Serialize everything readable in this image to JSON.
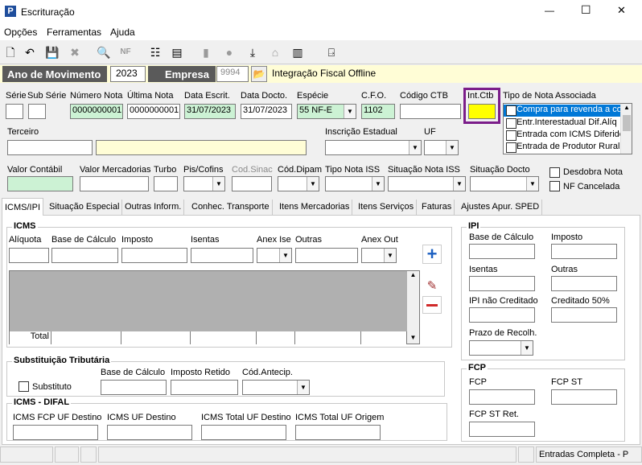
{
  "window": {
    "title": "Escrituração",
    "minimize": "—",
    "maximize": "☐",
    "close": "✕"
  },
  "menu": [
    "Opções",
    "Ferramentas",
    "Ajuda"
  ],
  "header": {
    "ano_label": "Ano de Movimento",
    "ano_value": "2023",
    "empresa_label": "Empresa",
    "empresa_code": "9994",
    "empresa_name": "Integração Fiscal Offline"
  },
  "labels": {
    "serie": "Série",
    "subserie": "Sub Série",
    "numero_nota": "Número Nota",
    "ultima_nota": "Última Nota",
    "data_escrit": "Data Escrit.",
    "data_docto": "Data Docto.",
    "especie": "Espécie",
    "cfo": "C.F.O.",
    "codigo_ctb": "Código CTB",
    "int_ctb": "Int.Ctb",
    "tipo_nota_assoc": "Tipo de Nota Associada",
    "terceiro": "Terceiro",
    "inscricao": "Inscrição Estadual",
    "uf": "UF",
    "valor_contabil": "Valor Contábil",
    "valor_mercadorias": "Valor Mercadorias",
    "turbo": "Turbo",
    "pis_cofins": "Pis/Cofins",
    "cod_sinac": "Cod.Sinac",
    "cod_dipam": "Cód.Dipam",
    "tipo_nota_iss": "Tipo Nota ISS",
    "situacao_nota_iss": "Situação Nota ISS",
    "situacao_docto": "Situação Docto",
    "desdobra_nota": "Desdobra Nota",
    "nf_cancelada": "NF Cancelada"
  },
  "values": {
    "numero_nota": "0000000001",
    "ultima_nota": "0000000001",
    "data_escrit": "31/07/2023",
    "data_docto": "31/07/2023",
    "especie": "55   NF-E",
    "cfo": "1102"
  },
  "tipo_nota_options": [
    "Compra para revenda a co",
    "Entr.Interestadual Dif.Alíq",
    "Entrada com ICMS Diferido",
    "Entrada de Produtor Rural"
  ],
  "tabs": [
    "ICMS/IPI",
    "Situação Especial",
    "Outras Inform.",
    "Conhec. Transporte",
    "Itens Mercadorias",
    "Itens Serviços",
    "Faturas",
    "Ajustes Apur. SPED"
  ],
  "icms": {
    "title": "ICMS",
    "aliquota": "Alíquota",
    "base_calculo": "Base de Cálculo",
    "imposto": "Imposto",
    "isentas": "Isentas",
    "anex_ise": "Anex Ise",
    "outras": "Outras",
    "anex_out": "Anex Out",
    "total": "Total"
  },
  "ipi": {
    "title": "IPI",
    "base_calculo": "Base de Cálculo",
    "imposto": "Imposto",
    "isentas": "Isentas",
    "outras": "Outras",
    "ipi_nao_creditado": "IPI não Creditado",
    "creditado_50": "Creditado 50%",
    "prazo": "Prazo de Recolh."
  },
  "st": {
    "title": "Substituição Tributária",
    "substituto": "Substituto",
    "base_calculo": "Base de Cálculo",
    "imposto_retido": "Imposto Retido",
    "cod_antecip": "Cód.Antecip."
  },
  "difal": {
    "title": "ICMS - DIFAL",
    "fcp_uf_destino": "ICMS FCP UF Destino",
    "uf_destino": "ICMS UF Destino",
    "total_uf_destino": "ICMS Total UF Destino",
    "total_uf_origem": "ICMS Total UF Origem"
  },
  "fcp": {
    "title": "FCP",
    "fcp": "FCP",
    "fcp_st": "FCP ST",
    "fcp_st_ret": "FCP ST Ret."
  },
  "statusbar": {
    "mode": "Entradas Completa - P"
  }
}
